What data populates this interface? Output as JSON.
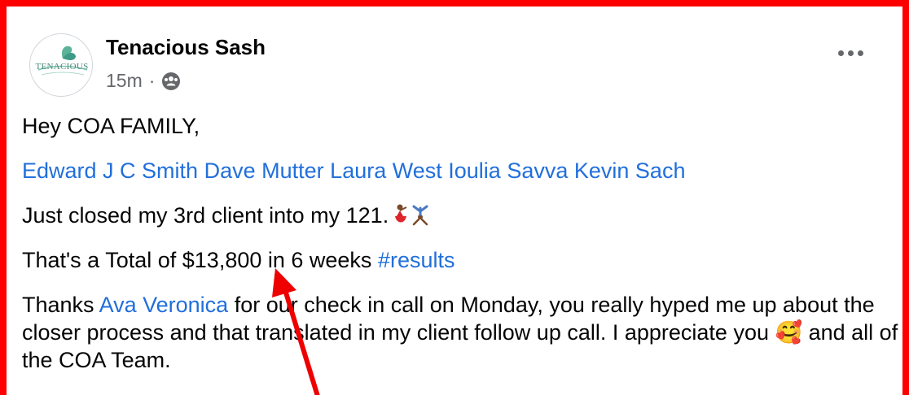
{
  "post": {
    "author": "Tenacious Sash",
    "timestamp": "15m",
    "separator": "·",
    "audience_icon": "group-audience-icon",
    "more_icon": "more-options-icon"
  },
  "avatar": {
    "logo_text": "TENACIOUS"
  },
  "content": {
    "greeting": "Hey COA FAMILY,",
    "tags": [
      "Edward J C Smith",
      "Dave Mutter",
      "Laura West",
      "Ioulia Savva",
      "Kevin Sach"
    ],
    "line3": "Just closed my 3rd client into my 121.",
    "line4_text": "That's a Total of $13,800 in 6 weeks ",
    "hashtag": "#results",
    "line5_start": "Thanks ",
    "mention": "Ava Veronica",
    "line5_rest": " for our check in call on Monday, you really hyped me up about the closer process and that translated in my client follow up call. I appreciate you ",
    "emoji_smile": "🥰",
    "line5_end": " and all of the COA Team."
  },
  "colors": {
    "link": "#216fdb",
    "annotation": "#ee0000",
    "border": "#ff0000"
  }
}
